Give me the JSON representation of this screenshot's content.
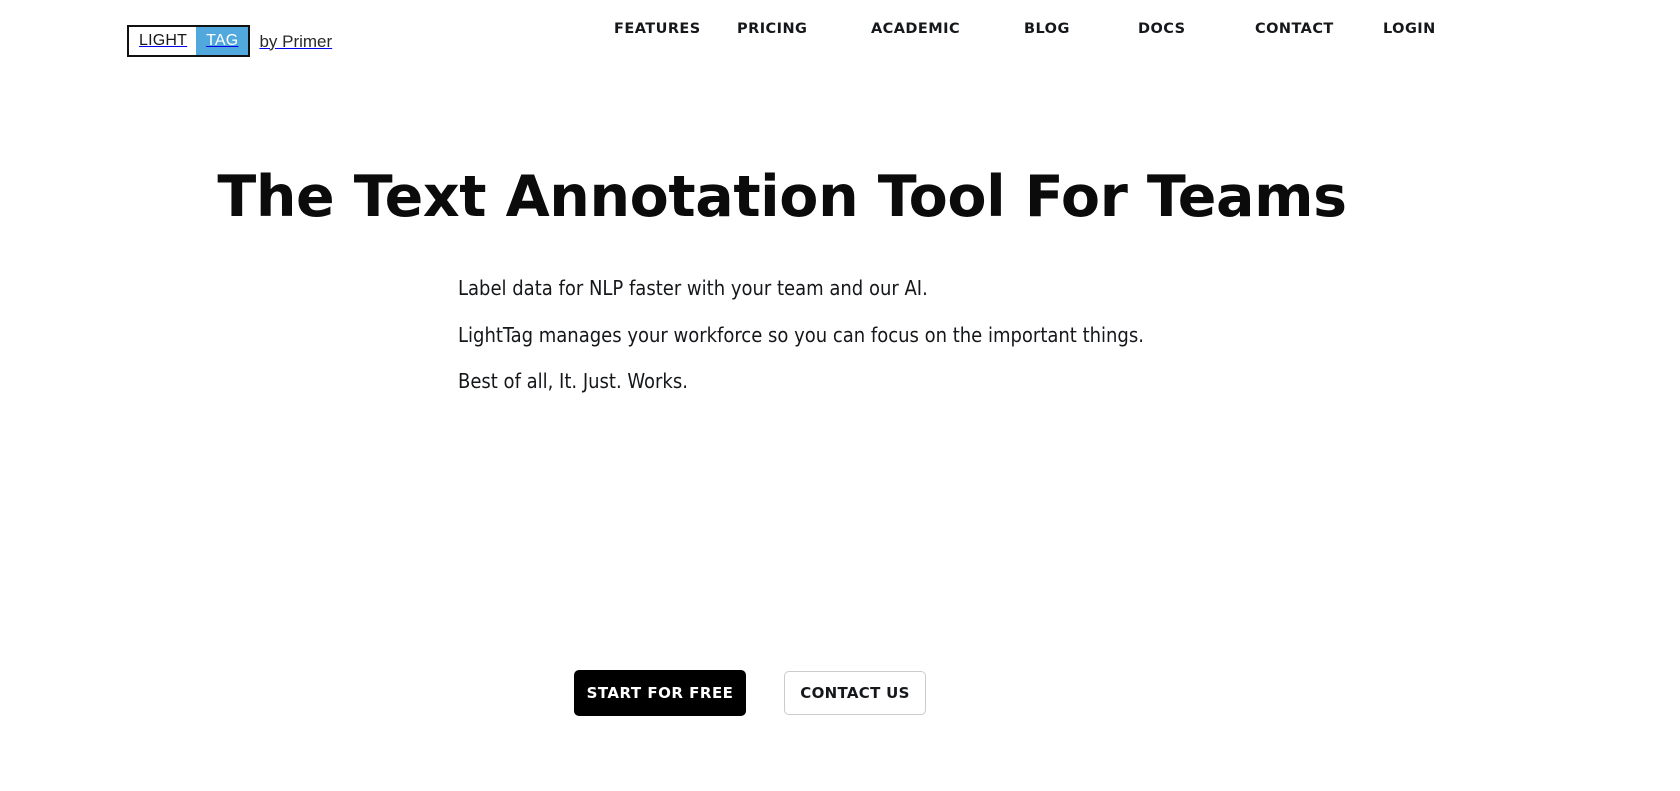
{
  "colors": {
    "page_background": "#ffffff",
    "text": "#15171a",
    "tag_badge_blue": "#51a8dd",
    "primary_button_bg": "#000000",
    "primary_button_text": "#ffffff",
    "secondary_button_border": "#c9cbcd"
  },
  "header": {
    "brand": {
      "logo_light": "LIGHT",
      "logo_tag": "TAG",
      "byline": "by Primer"
    },
    "nav": [
      {
        "label": "FEATURES"
      },
      {
        "label": "PRICING"
      },
      {
        "label": "ACADEMIC"
      },
      {
        "label": "BLOG"
      },
      {
        "label": "DOCS"
      },
      {
        "label": "CONTACT"
      },
      {
        "label": "LOGIN"
      }
    ]
  },
  "hero": {
    "headline": "The Text Annotation Tool For Teams",
    "paragraphs": [
      "Label data for NLP faster with your team and our AI.",
      "LightTag manages your workforce so you can focus on the important things.",
      "Best of all, It. Just. Works."
    ]
  },
  "cta": {
    "primary_label": "START FOR FREE",
    "secondary_label": "CONTACT US"
  }
}
